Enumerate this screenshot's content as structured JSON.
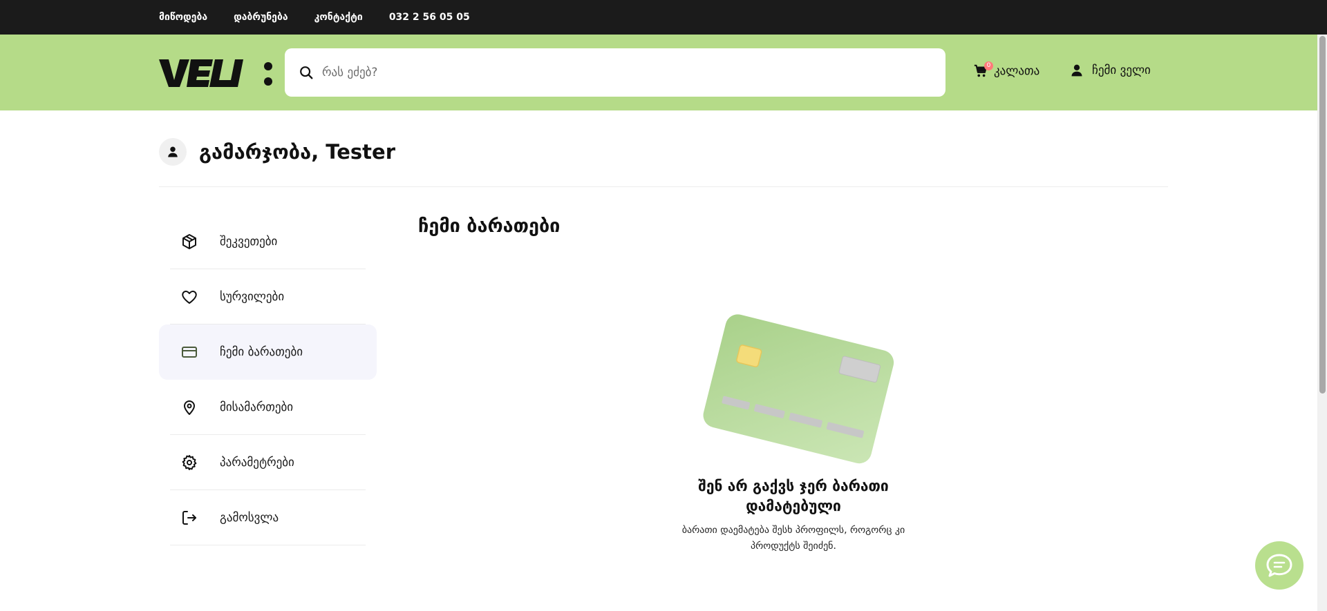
{
  "topbar": {
    "links": [
      "მიწოდება",
      "დაბრუნება",
      "კონტაქტი",
      "032 2 56 05 05"
    ]
  },
  "header": {
    "logo_text": "VELI:",
    "search": {
      "placeholder": "რას ეძებ?",
      "value": ""
    },
    "cart": {
      "label": "კალათა",
      "count": "0"
    },
    "account": {
      "label": "ჩემი ველი"
    }
  },
  "greeting": {
    "text": "გამარჯობა, Tester"
  },
  "sidebar": {
    "items": [
      {
        "label": "შეკვეთები",
        "icon": "package-icon",
        "active": false
      },
      {
        "label": "სურვილები",
        "icon": "heart-icon",
        "active": false
      },
      {
        "label": "ჩემი ბარათები",
        "icon": "credit-card-icon",
        "active": true
      },
      {
        "label": "მისამართები",
        "icon": "map-pin-icon",
        "active": false
      },
      {
        "label": "პარამეტრები",
        "icon": "gear-icon",
        "active": false
      },
      {
        "label": "გამოსვლა",
        "icon": "logout-icon",
        "active": false
      }
    ]
  },
  "main": {
    "title": "ჩემი ბარათები",
    "empty_title": "შენ არ გაქვს ჯერ ბარათი დამატებული",
    "empty_description": "ბარათი დაემატება შესხ პროფილს, როგორც კი პროდუქტს შეიძენ."
  },
  "colors": {
    "topbar": "#1b1b1b",
    "header": "#b5db88",
    "accent": "#b9df8e",
    "badge": "#ff7a7a",
    "active_item_bg": "#f5f5fc"
  }
}
